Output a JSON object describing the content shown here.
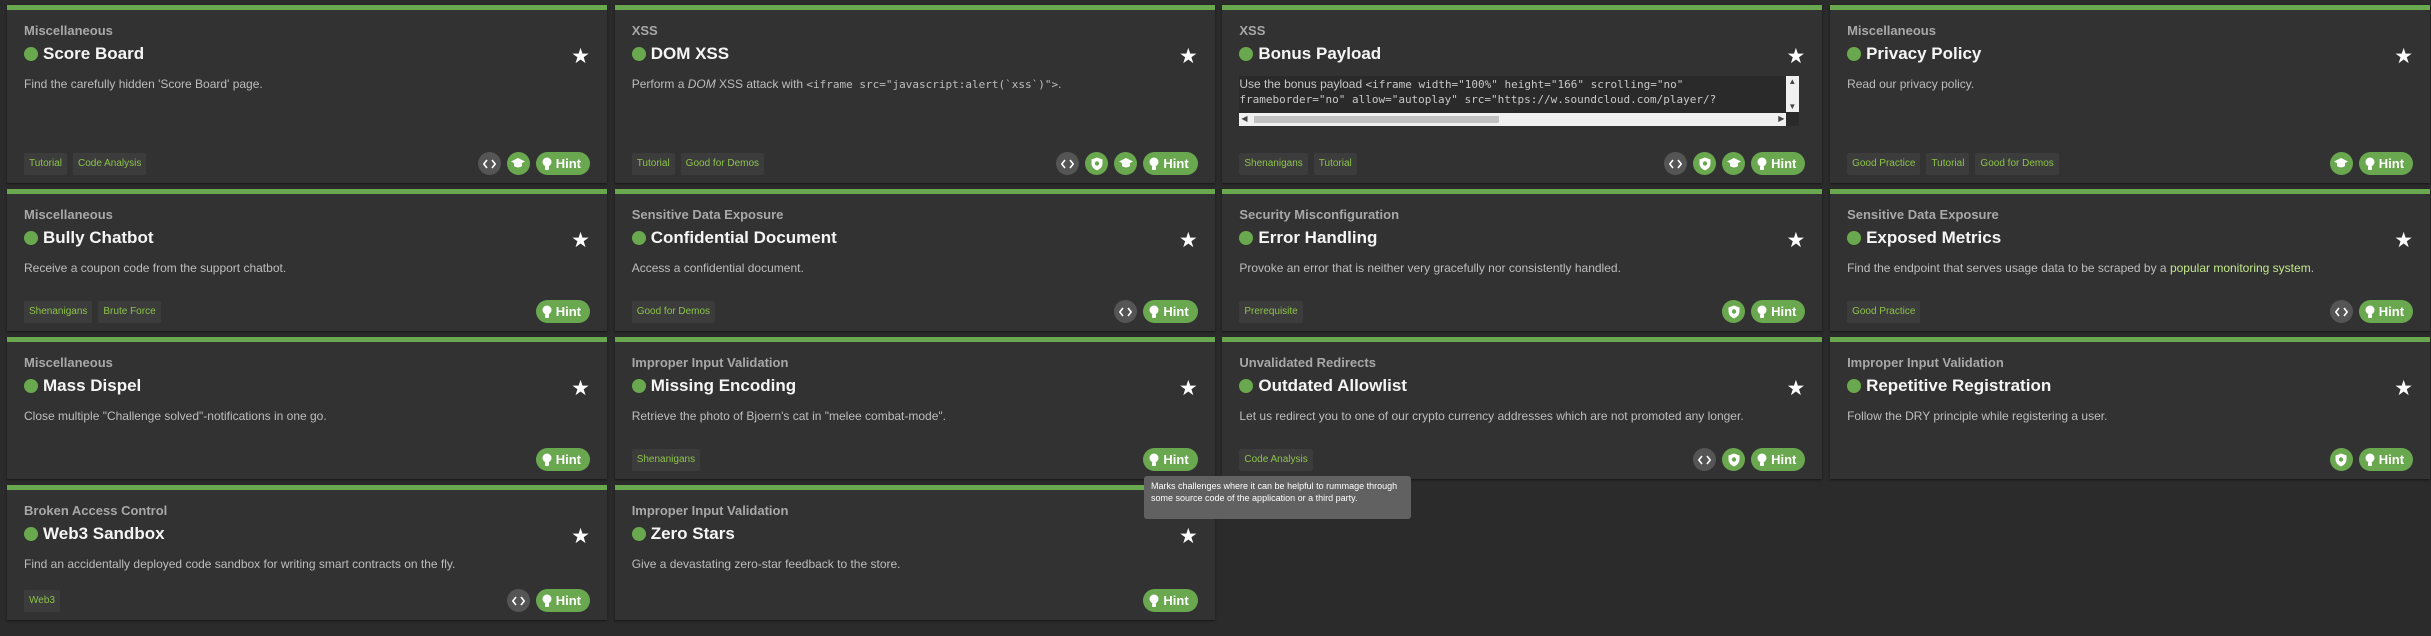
{
  "hint_label": "Hint",
  "tooltip_text": "Marks challenges where it can be helpful to rummage through some source code of the application or a third party.",
  "colors": {
    "accent": "#6aa84f",
    "tag_text": "#8bc34a",
    "background": "#2b2b2b",
    "card": "#323232"
  },
  "cards": [
    {
      "category": "Miscellaneous",
      "title": "Score Board",
      "description": "Find the carefully hidden 'Score Board' page.",
      "tags": [
        "Tutorial",
        "Code Analysis"
      ],
      "icons": [
        "code-icon",
        "graduation-cap-icon"
      ]
    },
    {
      "category": "XSS",
      "title": "DOM XSS",
      "description_pre": "Perform a ",
      "description_em": "DOM",
      "description_mid": " XSS attack with ",
      "description_code": "<iframe src=\"javascript:alert(`xss`)\">",
      "description_post": ".",
      "tags": [
        "Tutorial",
        "Good for Demos"
      ],
      "icons": [
        "code-icon",
        "shield-icon",
        "graduation-cap-icon"
      ]
    },
    {
      "category": "XSS",
      "title": "Bonus Payload",
      "description_pre": "Use the bonus payload ",
      "payload_line1": "<iframe width=\"100%\" height=\"166\" scrolling=\"no\"",
      "payload_line2": "frameborder=\"no\" allow=\"autoplay\" src=\"https://w.soundcloud.com/player/?",
      "tags": [
        "Shenanigans",
        "Tutorial"
      ],
      "icons": [
        "code-icon",
        "shield-icon",
        "graduation-cap-icon"
      ]
    },
    {
      "category": "Miscellaneous",
      "title": "Privacy Policy",
      "description": "Read our privacy policy.",
      "tags": [
        "Good Practice",
        "Tutorial",
        "Good for Demos"
      ],
      "icons": [
        "graduation-cap-icon"
      ]
    },
    {
      "category": "Miscellaneous",
      "title": "Bully Chatbot",
      "description": "Receive a coupon code from the support chatbot.",
      "tags": [
        "Shenanigans",
        "Brute Force"
      ],
      "icons": []
    },
    {
      "category": "Sensitive Data Exposure",
      "title": "Confidential Document",
      "description": "Access a confidential document.",
      "tags": [
        "Good for Demos"
      ],
      "icons": [
        "code-icon"
      ]
    },
    {
      "category": "Security Misconfiguration",
      "title": "Error Handling",
      "description": "Provoke an error that is neither very gracefully nor consistently handled.",
      "tags": [
        "Prerequisite"
      ],
      "icons": [
        "shield-icon"
      ]
    },
    {
      "category": "Sensitive Data Exposure",
      "title": "Exposed Metrics",
      "description_pre": "Find the endpoint that serves usage data to be scraped by a ",
      "description_link": "popular monitoring system",
      "description_post": ".",
      "tags": [
        "Good Practice"
      ],
      "icons": [
        "code-icon"
      ]
    },
    {
      "category": "Miscellaneous",
      "title": "Mass Dispel",
      "description": "Close multiple \"Challenge solved\"-notifications in one go.",
      "tags": [],
      "icons": []
    },
    {
      "category": "Improper Input Validation",
      "title": "Missing Encoding",
      "description": "Retrieve the photo of Bjoern's cat in \"melee combat-mode\".",
      "tags": [
        "Shenanigans"
      ],
      "icons": []
    },
    {
      "category": "Unvalidated Redirects",
      "title": "Outdated Allowlist",
      "description": "Let us redirect you to one of our crypto currency addresses which are not promoted any longer.",
      "tags": [
        "Code Analysis"
      ],
      "icons": [
        "code-icon",
        "shield-icon"
      ]
    },
    {
      "category": "Improper Input Validation",
      "title": "Repetitive Registration",
      "description": "Follow the DRY principle while registering a user.",
      "tags": [],
      "icons": [
        "shield-icon"
      ]
    },
    {
      "category": "Broken Access Control",
      "title": "Web3 Sandbox",
      "description": "Find an accidentally deployed code sandbox for writing smart contracts on the fly.",
      "tags": [
        "Web3"
      ],
      "icons": [
        "code-icon"
      ]
    },
    {
      "category": "Improper Input Validation",
      "title": "Zero Stars",
      "description": "Give a devastating zero-star feedback to the store.",
      "tags": [],
      "icons": []
    }
  ]
}
